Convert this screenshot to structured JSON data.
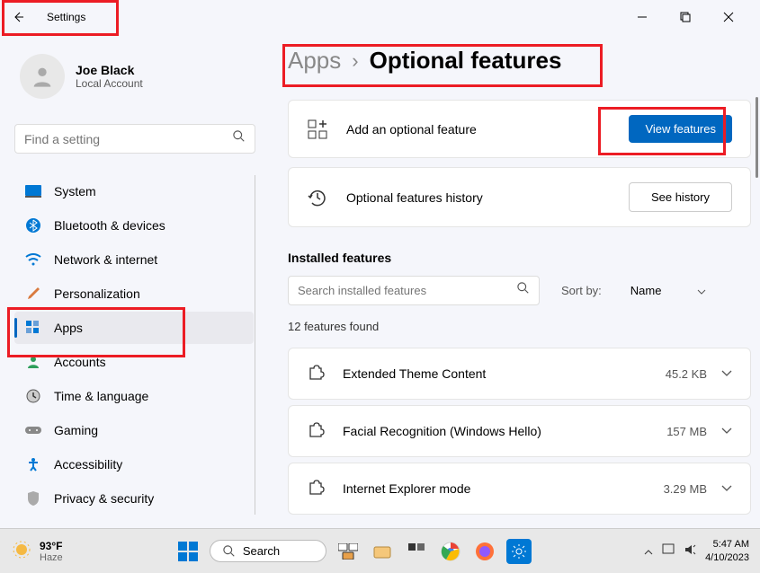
{
  "titlebar": {
    "title": "Settings"
  },
  "profile": {
    "name": "Joe Black",
    "sub": "Local Account"
  },
  "search": {
    "placeholder": "Find a setting"
  },
  "nav": {
    "items": [
      {
        "label": "System"
      },
      {
        "label": "Bluetooth & devices"
      },
      {
        "label": "Network & internet"
      },
      {
        "label": "Personalization"
      },
      {
        "label": "Apps"
      },
      {
        "label": "Accounts"
      },
      {
        "label": "Time & language"
      },
      {
        "label": "Gaming"
      },
      {
        "label": "Accessibility"
      },
      {
        "label": "Privacy & security"
      }
    ]
  },
  "breadcrumb": {
    "parent": "Apps",
    "current": "Optional features"
  },
  "cards": {
    "add": {
      "title": "Add an optional feature",
      "button": "View features"
    },
    "history": {
      "title": "Optional features history",
      "button": "See history"
    }
  },
  "installed": {
    "title": "Installed features",
    "search_placeholder": "Search installed features",
    "sort_label": "Sort by:",
    "sort_value": "Name",
    "count": "12 features found",
    "features": [
      {
        "name": "Extended Theme Content",
        "size": "45.2 KB"
      },
      {
        "name": "Facial Recognition (Windows Hello)",
        "size": "157 MB"
      },
      {
        "name": "Internet Explorer mode",
        "size": "3.29 MB"
      }
    ]
  },
  "taskbar": {
    "temp": "93°F",
    "condition": "Haze",
    "search": "Search",
    "time": "5:47 AM",
    "date": "4/10/2023"
  }
}
